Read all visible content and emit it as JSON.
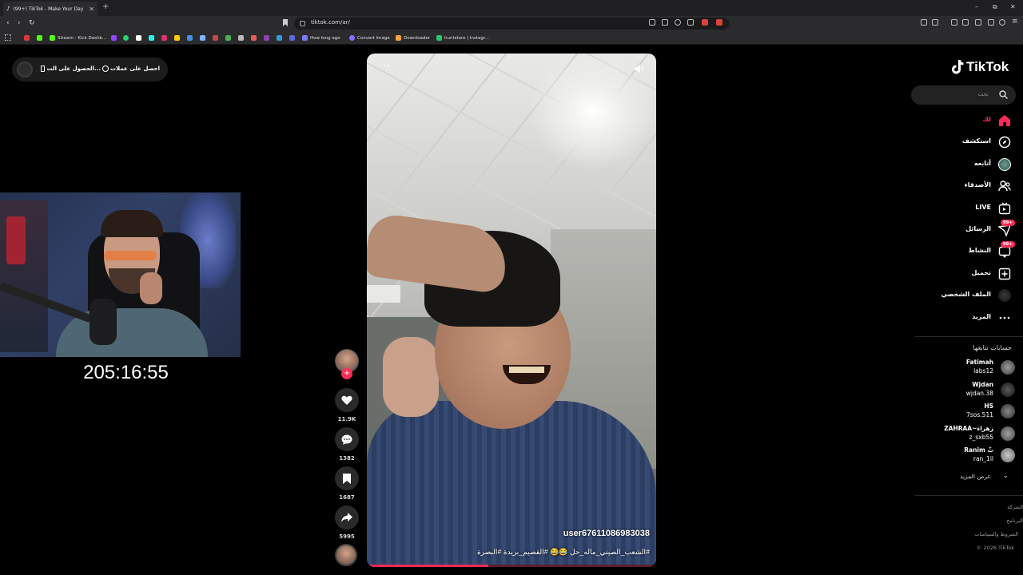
{
  "browser": {
    "tab_title": "(99+) TikTok - Make Your Day",
    "new_tab": "+",
    "url": "tiktok.com/ar/",
    "minimize": "–",
    "maximize": "⧉",
    "close": "✕",
    "back": "‹",
    "forward": "›",
    "reload": "↻"
  },
  "bookmarks": [
    {
      "label": "",
      "color": "#d83a3a"
    },
    {
      "label": "",
      "color": "#53fc18"
    },
    {
      "label": "Stream - Kick Dashb...",
      "color": "#53fc18"
    },
    {
      "label": "",
      "color": "#9146ff"
    },
    {
      "label": "",
      "color": "#25d366"
    },
    {
      "label": "",
      "color": "#ffffff"
    },
    {
      "label": "",
      "color": "#25f4ee"
    },
    {
      "label": "",
      "color": "#e1306c"
    },
    {
      "label": "",
      "color": "#ffcc00"
    },
    {
      "label": "How long ago",
      "color": "#7b7bff"
    },
    {
      "label": "Convert Image",
      "color": "#8a6cff"
    },
    {
      "label": "Downloader",
      "color": "#f4a340"
    },
    {
      "label": "huntstore | Instagr...",
      "color": "#28c76f"
    }
  ],
  "promo": {
    "item1": "احصل على عملات",
    "item2": "الحصول على الت..."
  },
  "stream": {
    "timer": "205:16:55"
  },
  "video": {
    "more": "···",
    "username": "user67611086983038",
    "caption": "#الشعب_الصيني_ماله_حل 😂😂 #القصيم_بريدة #البصرة",
    "progress": 0.42
  },
  "actions": {
    "likes": "11.9K",
    "comments": "1382",
    "saves": "1687",
    "shares": "5995"
  },
  "sidebar": {
    "logo": "TikTok",
    "search_placeholder": "بحث",
    "nav": [
      {
        "label": "لك",
        "icon": "home-icon",
        "active": true
      },
      {
        "label": "استكشف",
        "icon": "compass-icon"
      },
      {
        "label": "أتابعه",
        "icon": "following-avatar-icon"
      },
      {
        "label": "الأصدقاء",
        "icon": "friends-icon"
      },
      {
        "label": "LIVE",
        "icon": "live-icon"
      },
      {
        "label": "الرسائل",
        "icon": "messages-icon",
        "badge": "99+"
      },
      {
        "label": "النشاط",
        "icon": "activity-icon",
        "badge": "99+"
      },
      {
        "label": "تحميل",
        "icon": "upload-icon"
      },
      {
        "label": "الملف الشخصي",
        "icon": "profile-icon"
      },
      {
        "label": "المزيد",
        "icon": "more-icon"
      }
    ],
    "following_title": "حسابات تتابعها",
    "accounts": [
      {
        "name": "Fatimah",
        "handle": "labs12",
        "color": "#6b6b6b"
      },
      {
        "name": "Wjdan",
        "handle": "wjdan.38",
        "color": "#3b3b3b"
      },
      {
        "name": "HS",
        "handle": "7sos.511",
        "color": "#5a5a5a"
      },
      {
        "name": "ZAHRAA~زهراء",
        "handle": "z_sxb55",
        "color": "#7a7a7a"
      },
      {
        "name": "Ranim ثّ",
        "handle": "ran_1il",
        "color": "#888888"
      }
    ],
    "see_more": "عرض المزيد",
    "footer": [
      "الشركة",
      "البرنامج",
      "الشروط والسياسات",
      "© 2026 TikTok"
    ]
  },
  "colors": {
    "accent": "#fe2c55",
    "background": "#000000"
  }
}
